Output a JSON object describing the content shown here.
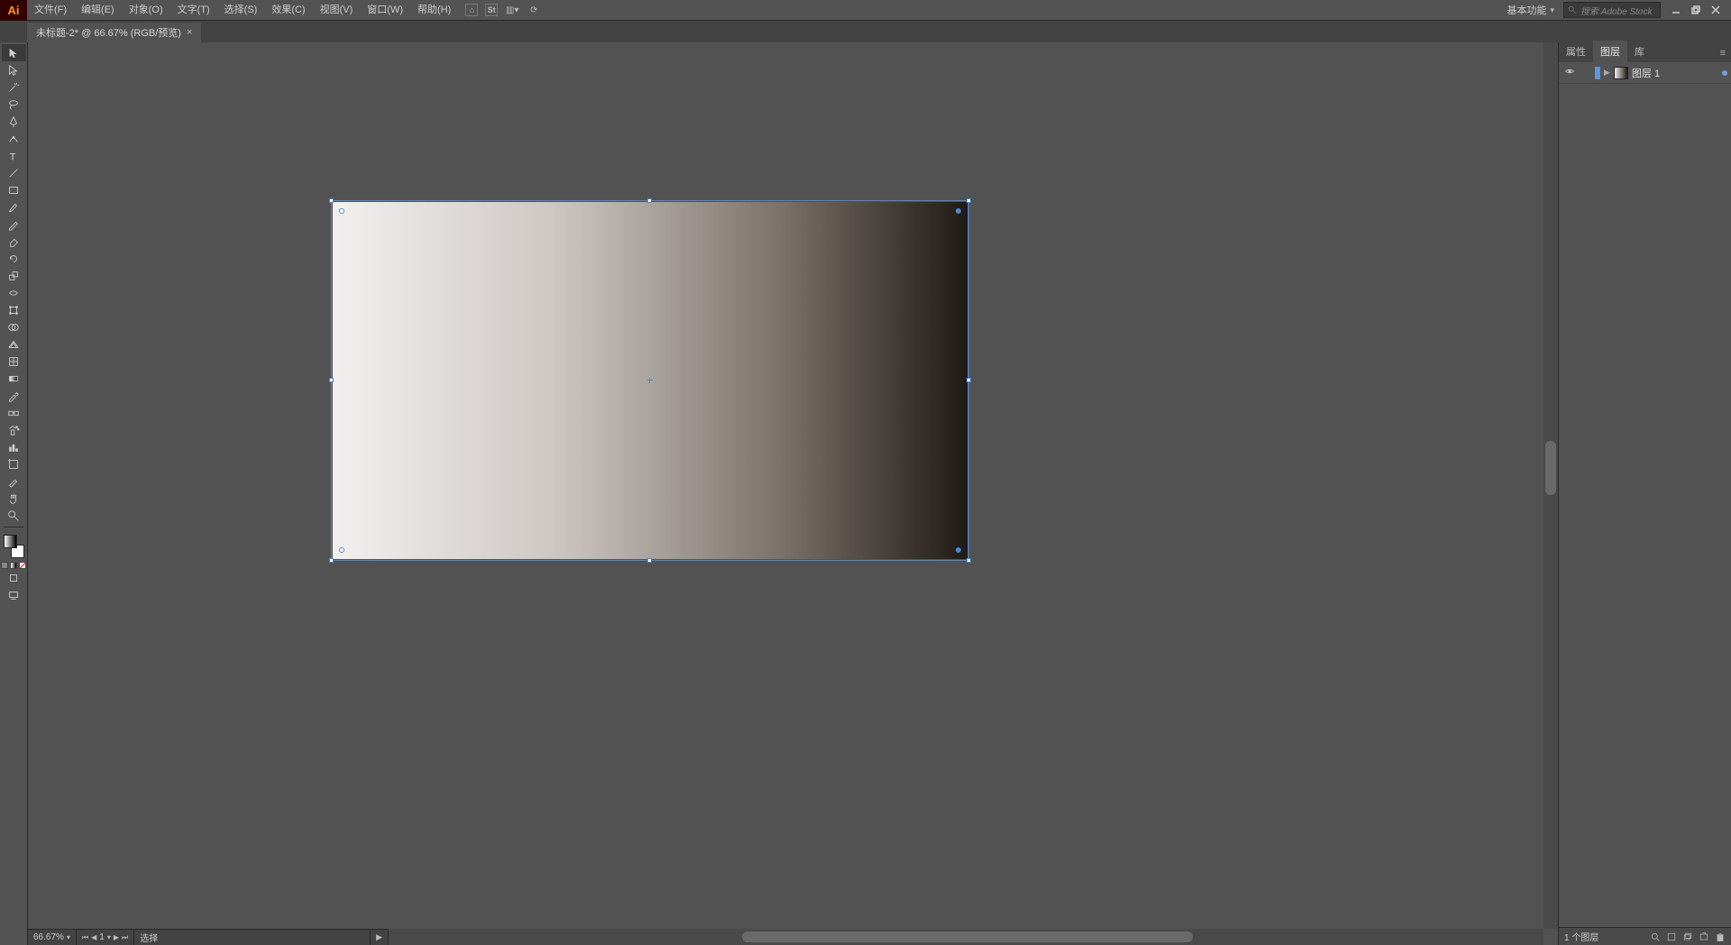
{
  "app": {
    "logo": "Ai"
  },
  "menu": {
    "file": "文件(F)",
    "edit": "编辑(E)",
    "object": "对象(O)",
    "type": "文字(T)",
    "select": "选择(S)",
    "effect": "效果(C)",
    "view": "视图(V)",
    "window": "窗口(W)",
    "help": "帮助(H)"
  },
  "workspace": {
    "name": "基本功能"
  },
  "search": {
    "placeholder": "搜索 Adobe Stock"
  },
  "doc_tab": {
    "title": "未标题-2* @ 66.67% (RGB/预览)"
  },
  "status": {
    "zoom": "66.67%",
    "artboard_index": "1",
    "tool": "选择"
  },
  "panels": {
    "tabs": {
      "properties": "属性",
      "layers": "图层",
      "libraries": "库"
    },
    "layer1_name": "图层 1",
    "status": "1 个图层"
  },
  "icons": {
    "selection": "selection",
    "direct": "direct",
    "wand": "wand",
    "lasso": "lasso",
    "pen": "pen",
    "curvature": "curvature",
    "type": "type",
    "line": "line",
    "rect": "rect",
    "brush": "brush",
    "pencil": "pencil",
    "eraser": "eraser",
    "rotate": "rotate",
    "scale": "scale",
    "width": "width",
    "freetrans": "freetrans",
    "shape_builder": "shape_builder",
    "perspective": "perspective",
    "mesh": "mesh",
    "gradient": "gradient",
    "eyedrop": "eyedrop",
    "blend": "blend",
    "symbol": "symbol",
    "graph": "graph",
    "artboard": "artboard",
    "slice": "slice",
    "hand": "hand",
    "zoom": "zoom"
  }
}
